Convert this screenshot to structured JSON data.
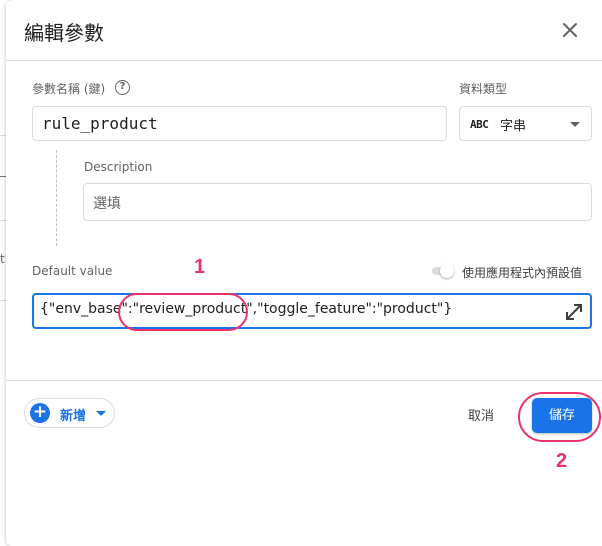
{
  "background": {
    "marks": [
      "_f",
      "t\""
    ]
  },
  "dialog": {
    "title": "編輯參數",
    "close_icon": "close-icon"
  },
  "param_name": {
    "label": "參數名稱 (鍵)",
    "help_icon": "?",
    "value": "rule_product"
  },
  "data_type": {
    "label": "資料類型",
    "badge": "ABC",
    "selected": "字串"
  },
  "description": {
    "label": "Description",
    "placeholder": "選填"
  },
  "default_value": {
    "label": "Default value",
    "toggle_label": "使用應用程式內預設值",
    "toggle_on": false,
    "value": "{\"env_base\":\"review_product\",\"toggle_feature\":\"product\"}"
  },
  "footer": {
    "add_icon": "+",
    "add_label": "新增",
    "cancel_label": "取消",
    "save_label": "儲存"
  },
  "annotations": {
    "marker_1": "1",
    "marker_2": "2",
    "color": "#e8336d"
  },
  "colors": {
    "accent": "#1a73e8",
    "annotation": "#e8336d"
  }
}
